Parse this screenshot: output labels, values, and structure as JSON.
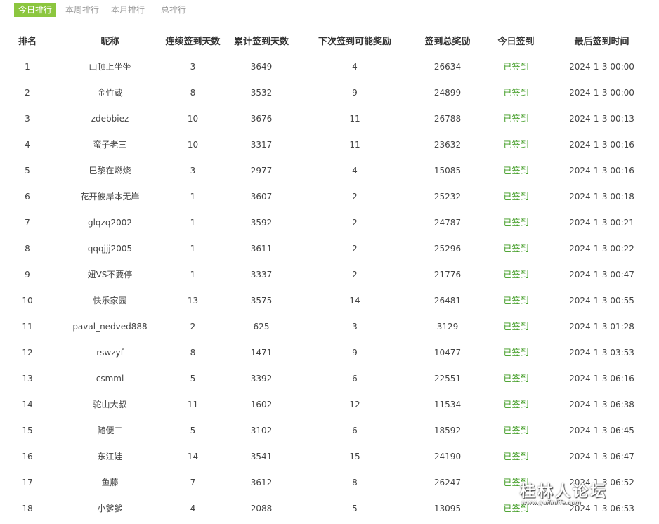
{
  "tabs": [
    {
      "label": "今日排行",
      "active": true
    },
    {
      "label": "本周排行",
      "active": false
    },
    {
      "label": "本月排行",
      "active": false
    },
    {
      "label": "总排行",
      "active": false
    }
  ],
  "table": {
    "headers": [
      "排名",
      "昵称",
      "连续签到天数",
      "累计签到天数",
      "下次签到可能奖励",
      "签到总奖励",
      "今日签到",
      "最后签到时间"
    ],
    "rows": [
      [
        "1",
        "山顶上坐坐",
        "3",
        "3649",
        "4",
        "26634",
        "已签到",
        "2024-1-3 00:00"
      ],
      [
        "2",
        "金竹蔵",
        "8",
        "3532",
        "9",
        "24899",
        "已签到",
        "2024-1-3 00:00"
      ],
      [
        "3",
        "zdebbiez",
        "10",
        "3676",
        "11",
        "26788",
        "已签到",
        "2024-1-3 00:13"
      ],
      [
        "4",
        "蛮子老三",
        "10",
        "3317",
        "11",
        "23632",
        "已签到",
        "2024-1-3 00:16"
      ],
      [
        "5",
        "巴黎在燃烧",
        "3",
        "2977",
        "4",
        "15085",
        "已签到",
        "2024-1-3 00:16"
      ],
      [
        "6",
        "花开彼岸本无岸",
        "1",
        "3607",
        "2",
        "25232",
        "已签到",
        "2024-1-3 00:18"
      ],
      [
        "7",
        "glqzq2002",
        "1",
        "3592",
        "2",
        "24787",
        "已签到",
        "2024-1-3 00:21"
      ],
      [
        "8",
        "qqqjjj2005",
        "1",
        "3611",
        "2",
        "25296",
        "已签到",
        "2024-1-3 00:22"
      ],
      [
        "9",
        "妞VS不要停",
        "1",
        "3337",
        "2",
        "21776",
        "已签到",
        "2024-1-3 00:47"
      ],
      [
        "10",
        "快乐家园",
        "13",
        "3575",
        "14",
        "26481",
        "已签到",
        "2024-1-3 00:55"
      ],
      [
        "11",
        "paval_nedved888",
        "2",
        "625",
        "3",
        "3129",
        "已签到",
        "2024-1-3 01:28"
      ],
      [
        "12",
        "rswzyf",
        "8",
        "1471",
        "9",
        "10477",
        "已签到",
        "2024-1-3 03:53"
      ],
      [
        "13",
        "csmml",
        "5",
        "3392",
        "6",
        "22551",
        "已签到",
        "2024-1-3 06:16"
      ],
      [
        "14",
        "驼山大叔",
        "11",
        "1602",
        "12",
        "11534",
        "已签到",
        "2024-1-3 06:38"
      ],
      [
        "15",
        "随便二",
        "5",
        "3102",
        "6",
        "18592",
        "已签到",
        "2024-1-3 06:45"
      ],
      [
        "16",
        "东江娃",
        "14",
        "3541",
        "15",
        "24190",
        "已签到",
        "2024-1-3 06:47"
      ],
      [
        "17",
        "鱼藤",
        "7",
        "3612",
        "8",
        "26247",
        "已签到",
        "2024-1-3 06:52"
      ],
      [
        "18",
        "小爹爹",
        "4",
        "2088",
        "5",
        "13095",
        "已签到",
        "2024-1-3 06:53"
      ]
    ]
  },
  "watermark": {
    "main": "桂林人论坛",
    "sub": "www.guilinlife.com"
  },
  "colors": {
    "active_tab_bg": "#8cc63f",
    "signed_status": "#3c9a1f"
  }
}
